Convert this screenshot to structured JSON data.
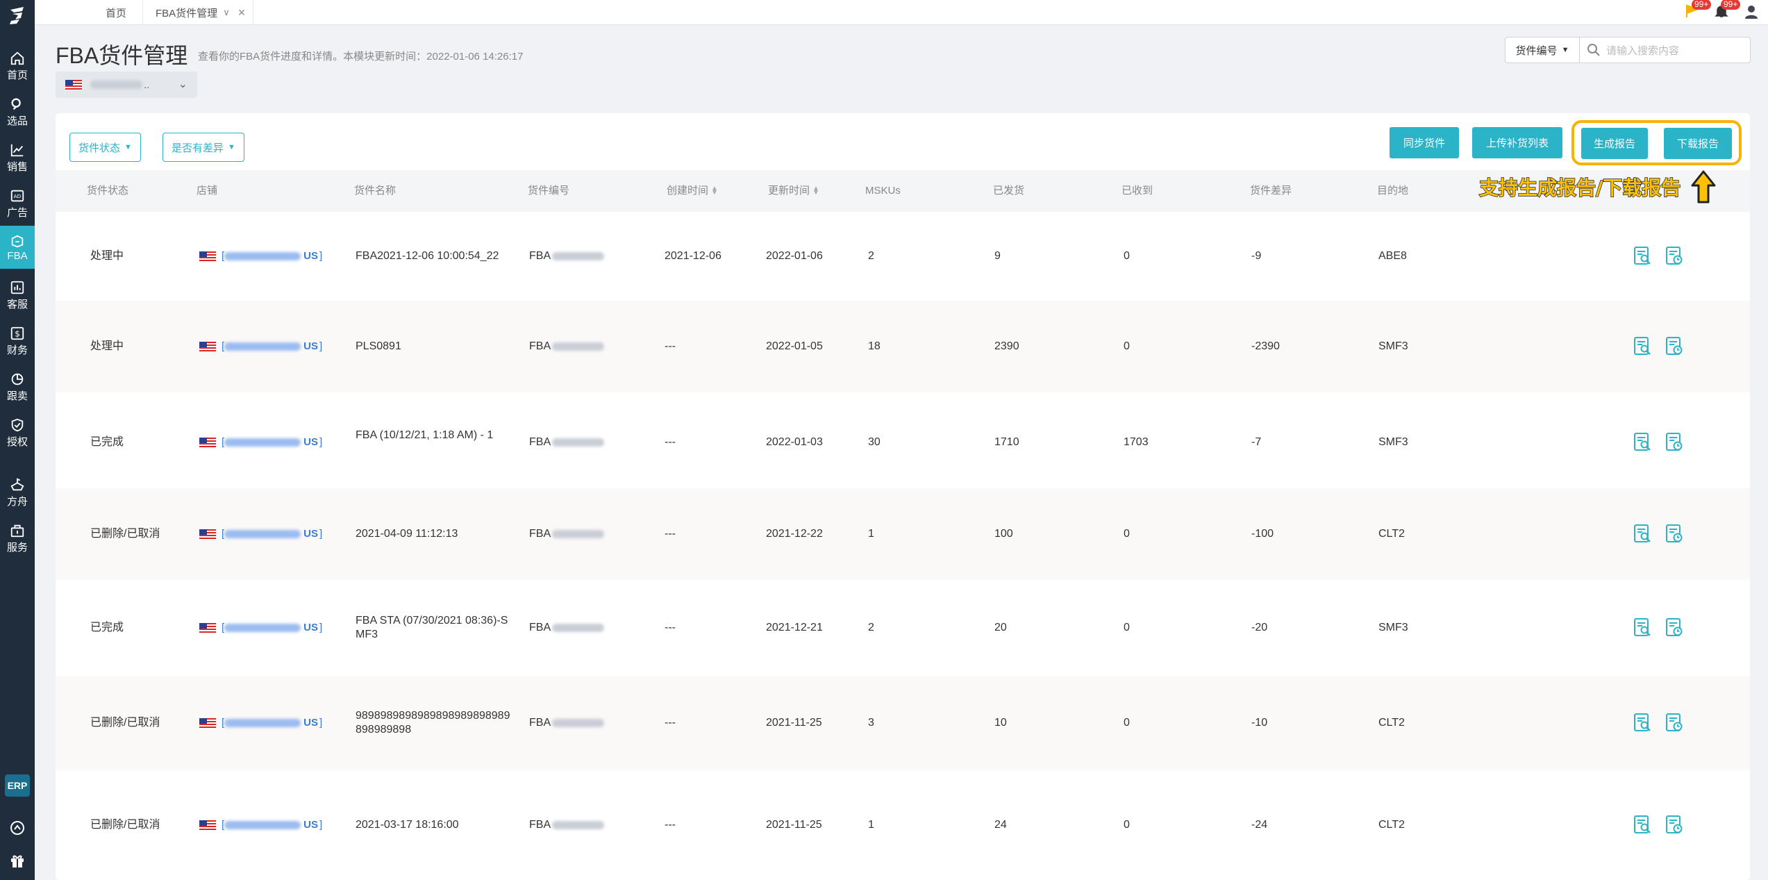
{
  "sidebar": {
    "items": [
      {
        "label": "首页",
        "icon": "home-icon"
      },
      {
        "label": "选品",
        "icon": "search-icon"
      },
      {
        "label": "销售",
        "icon": "chart-line-icon"
      },
      {
        "label": "广告",
        "icon": "ad-icon"
      },
      {
        "label": "FBA",
        "icon": "box-icon"
      },
      {
        "label": "客服",
        "icon": "bar-chart-icon"
      },
      {
        "label": "财务",
        "icon": "dollar-icon"
      },
      {
        "label": "跟卖",
        "icon": "pie-chart-icon"
      },
      {
        "label": "授权",
        "icon": "shield-icon"
      },
      {
        "label": "方舟",
        "icon": "ark-icon"
      },
      {
        "label": "服务",
        "icon": "service-icon"
      }
    ],
    "erp_label": "ERP",
    "accent_color": "#2bb3c8"
  },
  "topbar": {
    "tabs": [
      {
        "label": "首页"
      },
      {
        "label": "FBA货件管理"
      }
    ],
    "badge_1": "99+",
    "badge_2": "99+"
  },
  "header": {
    "title": "FBA货件管理",
    "description": "查看你的FBA货件进度和详情。本模块更新时间：2022-01-06 14:26:17",
    "store_suffix": ".."
  },
  "search": {
    "type_label": "货件编号",
    "placeholder": "请输入搜索内容"
  },
  "filters": {
    "status_label": "货件状态",
    "diff_label": "是否有差异"
  },
  "actions": {
    "sync_label": "同步货件",
    "upload_label": "上传补货列表",
    "generate_label": "生成报告",
    "download_label": "下载报告"
  },
  "annotation": {
    "text": "支持生成报告/下载报告"
  },
  "table": {
    "columns": [
      "货件状态",
      "店铺",
      "货件名称",
      "货件编号",
      "创建时间",
      "更新时间",
      "MSKUs",
      "已发货",
      "已收到",
      "货件差异",
      "目的地"
    ],
    "rows": [
      {
        "status": "处理中",
        "store": "US",
        "name": "FBA2021-12-06 10:00:54_22",
        "id_prefix": "FBA",
        "created": "2021-12-06",
        "updated": "2022-01-06",
        "mskus": "2",
        "shipped": "9",
        "received": "0",
        "diff": "-9",
        "dest": "ABE8"
      },
      {
        "status": "处理中",
        "store": "US",
        "name": "PLS0891",
        "id_prefix": "FBA",
        "created": "---",
        "updated": "2022-01-05",
        "mskus": "18",
        "shipped": "2390",
        "received": "0",
        "diff": "-2390",
        "dest": "SMF3"
      },
      {
        "status": "已完成",
        "store": "US",
        "name": "FBA (10/12/21, 1:18 AM) - 1",
        "id_prefix": "FBA",
        "created": "---",
        "updated": "2022-01-03",
        "mskus": "30",
        "shipped": "1710",
        "received": "1703",
        "diff": "-7",
        "dest": "SMF3"
      },
      {
        "status": "已删除/已取消",
        "store": "US",
        "name": "2021-04-09 11:12:13",
        "id_prefix": "FBA",
        "created": "---",
        "updated": "2021-12-22",
        "mskus": "1",
        "shipped": "100",
        "received": "0",
        "diff": "-100",
        "dest": "CLT2"
      },
      {
        "status": "已完成",
        "store": "US",
        "name": "FBA STA (07/30/2021 08:36)-SMF3",
        "id_prefix": "FBA",
        "created": "---",
        "updated": "2021-12-21",
        "mskus": "2",
        "shipped": "20",
        "received": "0",
        "diff": "-20",
        "dest": "SMF3"
      },
      {
        "status": "已删除/已取消",
        "store": "US",
        "name": "9898989898989898989898989898989898",
        "id_prefix": "FBA",
        "created": "---",
        "updated": "2021-11-25",
        "mskus": "3",
        "shipped": "10",
        "received": "0",
        "diff": "-10",
        "dest": "CLT2"
      },
      {
        "status": "已删除/已取消",
        "store": "US",
        "name": "2021-03-17 18:16:00",
        "id_prefix": "FBA",
        "created": "---",
        "updated": "2021-11-25",
        "mskus": "1",
        "shipped": "24",
        "received": "0",
        "diff": "-24",
        "dest": "CLT2"
      }
    ]
  }
}
